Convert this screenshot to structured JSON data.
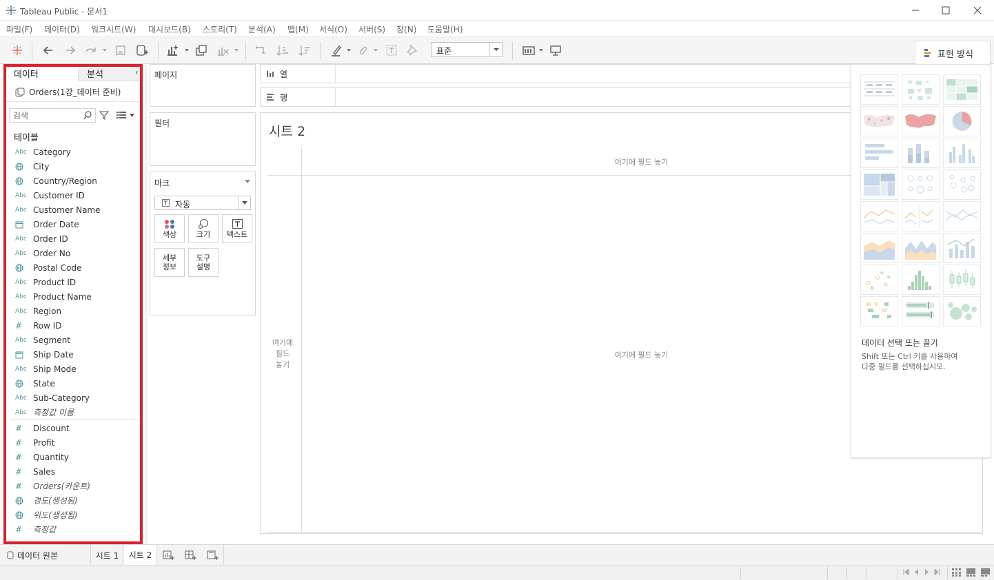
{
  "app": {
    "title": "Tableau Public - 문서1"
  },
  "menu": [
    "파일(F)",
    "데이터(D)",
    "워크시트(W)",
    "대시보드(B)",
    "스토리(T)",
    "분석(A)",
    "맵(M)",
    "서식(O)",
    "서버(S)",
    "창(N)",
    "도움말(H)"
  ],
  "toolbar": {
    "fit_value": "표준",
    "show_me_label": "표현 방식"
  },
  "data_pane": {
    "tabs": {
      "data": "데이터",
      "analysis": "분석"
    },
    "datasource": "Orders(1강_데이터 준비)",
    "search_placeholder": "검색",
    "tables_header": "테이블",
    "dimensions": [
      {
        "icon": "Abc",
        "name": "Category"
      },
      {
        "icon": "globe",
        "name": "City"
      },
      {
        "icon": "globe",
        "name": "Country/Region"
      },
      {
        "icon": "Abc",
        "name": "Customer ID"
      },
      {
        "icon": "Abc",
        "name": "Customer Name"
      },
      {
        "icon": "calendar",
        "name": "Order Date"
      },
      {
        "icon": "Abc",
        "name": "Order ID"
      },
      {
        "icon": "Abc",
        "name": "Order No"
      },
      {
        "icon": "globe",
        "name": "Postal Code"
      },
      {
        "icon": "Abc",
        "name": "Product ID"
      },
      {
        "icon": "Abc",
        "name": "Product Name"
      },
      {
        "icon": "Abc",
        "name": "Region"
      },
      {
        "icon": "#",
        "name": "Row ID"
      },
      {
        "icon": "Abc",
        "name": "Segment"
      },
      {
        "icon": "calendar",
        "name": "Ship Date"
      },
      {
        "icon": "Abc",
        "name": "Ship Mode"
      },
      {
        "icon": "globe",
        "name": "State"
      },
      {
        "icon": "Abc",
        "name": "Sub-Category"
      },
      {
        "icon": "Abc",
        "name": "측정값 이름",
        "italic": true
      }
    ],
    "measures": [
      {
        "icon": "#",
        "name": "Discount"
      },
      {
        "icon": "#",
        "name": "Profit"
      },
      {
        "icon": "#",
        "name": "Quantity"
      },
      {
        "icon": "#",
        "name": "Sales"
      },
      {
        "icon": "#",
        "name": "Orders(카운트)",
        "italic": true
      },
      {
        "icon": "globe",
        "name": "경도(생성됨)",
        "italic": true
      },
      {
        "icon": "globe",
        "name": "위도(생성됨)",
        "italic": true
      },
      {
        "icon": "#",
        "name": "측정값",
        "italic": true
      }
    ]
  },
  "cards": {
    "pages": "페이지",
    "filters": "필터",
    "marks": {
      "title": "마크",
      "type": "자동",
      "buttons": {
        "color": "색상",
        "size": "크기",
        "text": "텍스트",
        "detail_1": "세부",
        "detail_2": "정보",
        "tooltip_1": "도구",
        "tooltip_2": "설명"
      }
    }
  },
  "shelves": {
    "columns": "열",
    "rows": "행"
  },
  "sheet": {
    "title": "시트 2",
    "drop_field_top": "여기에 필드 놓기",
    "drop_field_center": "여기에 필드 놓기",
    "drop_field_left_1": "여기에",
    "drop_field_left_2": "필드",
    "drop_field_left_3": "놓기"
  },
  "show_me": {
    "heading": "데이터 선택 또는 끌기",
    "desc_1": "Shift 또는 Ctrl 키를 사용하여",
    "desc_2": "다중 필드를 선택하십시오."
  },
  "tabs": {
    "datasource": "데이터 원본",
    "sheet1": "시트 1",
    "sheet2": "시트 2"
  },
  "colors": {
    "accent_red": "#d9232e",
    "field_icon": "#4e9a9a",
    "chart_blue": "#4e79a7",
    "chart_orange": "#f28e2b"
  }
}
